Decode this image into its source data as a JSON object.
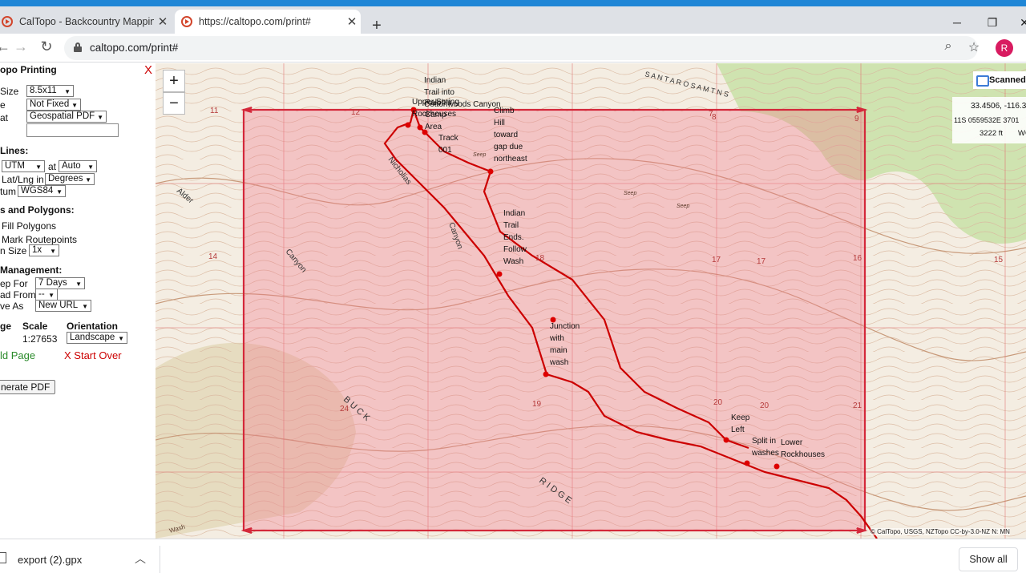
{
  "browser": {
    "tabs": [
      {
        "title": "CalTopo - Backcountry Mapping E",
        "active": false
      },
      {
        "title": "https://caltopo.com/print#",
        "active": true
      }
    ],
    "url": "caltopo.com/print#",
    "profile_initial": "R",
    "accent_color": "#1f86d6"
  },
  "panel": {
    "title": "opo Printing",
    "close_label": "X",
    "page_size_label": "Size",
    "page_size_value": "8.5x11",
    "scale_label": "e",
    "scale_value": "Not Fixed",
    "format_label": "at",
    "format_value": "Geospatial PDF",
    "grid_heading": "Lines:",
    "grid_type_value": "UTM",
    "grid_at_label": "at",
    "grid_at_value": "Auto",
    "latlng_label": "Lat/Lng in",
    "latlng_value": "Degrees",
    "datum_label": "tum",
    "datum_value": "WGS84",
    "lines_heading": "s and Polygons:",
    "fill_polygons_label": "Fill Polygons",
    "mark_routepoints_label": "Mark Routepoints",
    "icon_size_label": "n Size",
    "icon_size_value": "1x",
    "mgmt_heading": "Management:",
    "keep_for_label": "ep For",
    "keep_for_value": "7 Days",
    "load_from_label": "ad From",
    "load_from_value": "--",
    "save_as_label": "ve As",
    "save_as_value": "New URL",
    "col_page": "ge",
    "col_scale": "Scale",
    "col_orientation": "Orientation",
    "scale_readout": "1:27653",
    "orientation_value": "Landscape",
    "add_page_label": "ld Page",
    "start_over_label": "X Start Over",
    "generate_label": "nerate PDF",
    "add_color": "#2a8a2a",
    "close_color": "#cc0000"
  },
  "map": {
    "zoom_in": "+",
    "zoom_out": "−",
    "layer_button": "Scanned",
    "coord_latlng": "33.4506, -116.3",
    "coord_utm": "11S 0559532E 3701",
    "coord_elev": "3222 ft",
    "coord_datum": "WG",
    "attribution": "© CalTopo, USGS, NZTopo CC-by-3.0-NZ  N: MN",
    "route_color": "#cc0000",
    "print_frame_color": "#d4283a",
    "waypoints": [
      {
        "label": "Indian\nTrail into\nCottonwoods Canyon",
        "lines": 3
      },
      {
        "label": "Upper Spring\nRockhouses",
        "lines": 2
      },
      {
        "label": "Ralph's\nCamp\nArea",
        "lines": 3
      },
      {
        "label": "Track\n001",
        "lines": 2
      },
      {
        "label": "Climb\nHill\ntoward\ngap due\nnortheast",
        "lines": 5
      },
      {
        "label": "Indian\nTrail\nEnds.\nFollow\nWash",
        "lines": 5
      },
      {
        "label": "Junction\nwith\nmain\nwash",
        "lines": 4
      },
      {
        "label": "Keep\nLeft",
        "lines": 2
      },
      {
        "label": "Split in\nwashes",
        "lines": 2
      },
      {
        "label": "Lower\nRockhouses",
        "lines": 2
      }
    ],
    "section_numbers": [
      "11",
      "12",
      "7",
      "8",
      "9",
      "14",
      "13",
      "18",
      "17",
      "16",
      "15",
      "19",
      "20",
      "21",
      "24"
    ],
    "place_labels": [
      "Nicholias",
      "Canyon",
      "Canyon",
      "Alder",
      "B U C K",
      "R I D G E",
      "S A N T A  R O S A  M T N S",
      "Seep",
      "Wash"
    ]
  },
  "downloads": {
    "file_name": "export (2).gpx",
    "show_all": "Show all"
  }
}
